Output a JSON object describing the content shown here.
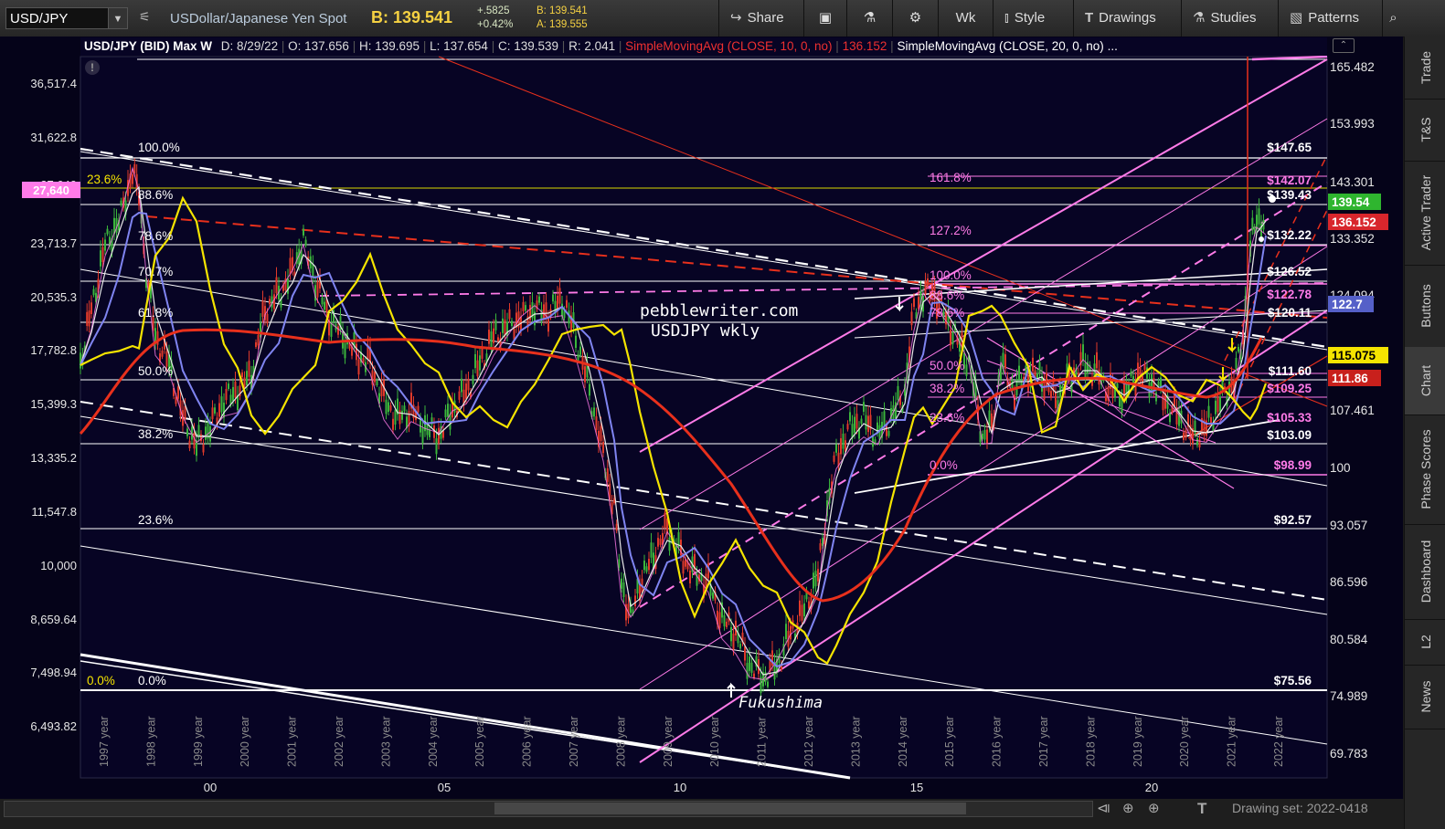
{
  "toolbar": {
    "symbol": "USD/JPY",
    "description": "USDollar/Japanese Yen Spot",
    "bid": "B: 139.541",
    "change": "+.5825",
    "change_pct": "+0.42%",
    "bid_small": "B: 139.541",
    "ask_small": "A: 139.555",
    "share": "Share",
    "period": "Wk",
    "style": "Style",
    "drawings": "Drawings",
    "studies": "Studies",
    "patterns": "Patterns"
  },
  "header": {
    "title": "USD/JPY (BID) Max W",
    "date": "D: 8/29/22",
    "open": "O: 137.656",
    "high": "H: 139.695",
    "low": "L: 137.654",
    "close": "C: 139.539",
    "range": "R: 2.041",
    "sma10": "SimpleMovingAvg (CLOSE, 10, 0, no)",
    "sma10_val": "136.152",
    "sma20": "SimpleMovingAvg (CLOSE, 20, 0, no)",
    "sma20_more": "..."
  },
  "watermark": {
    "line1": "pebblewriter.com",
    "line2": "USDJPY wkly"
  },
  "annotation": "Fukushima",
  "left_axis": [
    "36,517.4",
    "31,622.8",
    "27,640",
    "23,713.7",
    "20,535.3",
    "17,782.8",
    "15,399.3",
    "13,335.2",
    "11,547.8",
    "10,000",
    "8,659.64",
    "7,498.94",
    "6,493.82"
  ],
  "right_axis": [
    "165.482",
    "153.993",
    "143.301",
    "133.352",
    "124.094",
    "107.461",
    "100",
    "93.057",
    "86.596",
    "80.584",
    "74.989",
    "69.783"
  ],
  "right_badges": [
    {
      "label": "139.54",
      "color": "#2fb52f",
      "text": "#fff"
    },
    {
      "label": "136.152",
      "color": "#d8262c",
      "text": "#fff"
    },
    {
      "label": "122.7",
      "color": "#5560c8",
      "text": "#fff"
    },
    {
      "label": "115.075",
      "color": "#f5e400",
      "text": "#000"
    },
    {
      "label": "111.86",
      "color": "#c8201c",
      "text": "#fff"
    }
  ],
  "left_badge": "27,640",
  "fib_left": [
    "100.0%",
    "88.6%",
    "78.6%",
    "70.7%",
    "61.8%",
    "50.0%",
    "38.2%",
    "23.6%",
    "0.0%"
  ],
  "fib_left_yellow": [
    "23.6%",
    "0.0%"
  ],
  "fib_mid": [
    "161.8%",
    "127.2%",
    "100.0%",
    "88.6%",
    "78.6%",
    "50.0%",
    "38.2%",
    "23.6%",
    "0.0%"
  ],
  "price_labels": [
    "$147.65",
    "$142.07",
    "$139.43",
    "$132.22",
    "$126.52",
    "$122.78",
    "$120.11",
    "$111.60",
    "$109.25",
    "$105.33",
    "$103.09",
    "$98.99",
    "$92.57",
    "$75.56"
  ],
  "year_labels": [
    "1997 year",
    "1998 year",
    "1999 year",
    "2000 year",
    "2001 year",
    "2002 year",
    "2003 year",
    "2004 year",
    "2005 year",
    "2006 year",
    "2007 year",
    "2008 year",
    "2009 year",
    "2010 year",
    "2011 year",
    "2012 year",
    "2013 year",
    "2014 year",
    "2015 year",
    "2016 year",
    "2017 year",
    "2018 year",
    "2019 year",
    "2020 year",
    "2021 year",
    "2022 year"
  ],
  "x_axis": [
    "00",
    "05",
    "10",
    "15",
    "20"
  ],
  "sidebar": [
    "Trade",
    "T&S",
    "Active Trader",
    "Buttons",
    "Chart",
    "Phase Scores",
    "Dashboard",
    "L2",
    "News"
  ],
  "drawing_set": "Drawing set: 2022-0418",
  "colors": {
    "chart_bg": "#050319",
    "sma10": "#e8e8e8",
    "sma20": "#7f84f0",
    "sma50": "#f5e400",
    "sma100": "#e8301c",
    "fib_magenta": "#ff7be8",
    "candle_up": "#3bb53b",
    "candle_down": "#e03a2a"
  }
}
